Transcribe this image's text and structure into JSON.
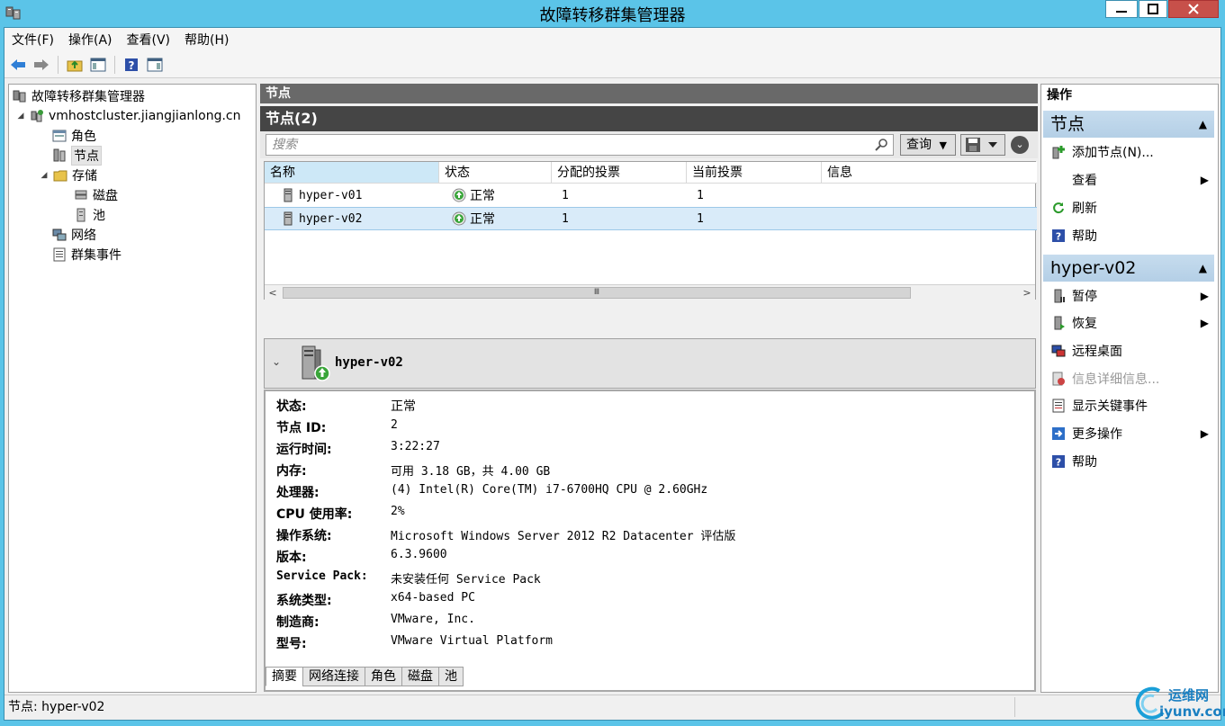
{
  "window": {
    "title": "故障转移群集管理器"
  },
  "menu": [
    "文件(F)",
    "操作(A)",
    "查看(V)",
    "帮助(H)"
  ],
  "tree": {
    "root": "故障转移群集管理器",
    "cluster": "vmhostcluster.jiangjianlong.cn",
    "roles": "角色",
    "nodes": "节点",
    "storage": "存储",
    "disks": "磁盘",
    "pools": "池",
    "network": "网络",
    "events": "群集事件"
  },
  "center": {
    "header": "节点",
    "subheader": "节点(2)",
    "search_placeholder": "搜索",
    "query_label": "查询",
    "columns": [
      "名称",
      "状态",
      "分配的投票",
      "当前投票",
      "信息"
    ],
    "rows": [
      {
        "name": "hyper-v01",
        "status": "正常",
        "assigned": "1",
        "current": "1",
        "info": ""
      },
      {
        "name": "hyper-v02",
        "status": "正常",
        "assigned": "1",
        "current": "1",
        "info": ""
      }
    ],
    "scroll_thumb": "Ⅲ"
  },
  "detail": {
    "name": "hyper-v02",
    "props": [
      {
        "k": "状态:",
        "v": "正常"
      },
      {
        "k": "节点 ID:",
        "v": "2"
      },
      {
        "k": "运行时间:",
        "v": "3:22:27"
      },
      {
        "k": "内存:",
        "v": "可用 3.18 GB，共 4.00 GB"
      },
      {
        "k": "处理器:",
        "v": "(4) Intel(R) Core(TM) i7-6700HQ CPU @ 2.60GHz"
      },
      {
        "k": "CPU 使用率:",
        "v": "2%"
      },
      {
        "k": "操作系统:",
        "v": "Microsoft Windows Server 2012 R2 Datacenter 评估版"
      },
      {
        "k": "版本:",
        "v": "6.3.9600"
      },
      {
        "k": "Service Pack:",
        "v": "未安装任何 Service Pack"
      },
      {
        "k": "系统类型:",
        "v": "x64-based PC"
      },
      {
        "k": "制造商:",
        "v": "VMware, Inc."
      },
      {
        "k": "型号:",
        "v": "VMware Virtual Platform"
      }
    ],
    "tabs": [
      "摘要",
      "网络连接",
      "角色",
      "磁盘",
      "池"
    ]
  },
  "actions": {
    "header": "操作",
    "section1": "节点",
    "section1_items": [
      "添加节点(N)...",
      "查看",
      "刷新",
      "帮助"
    ],
    "section2": "hyper-v02",
    "section2_items": [
      "暂停",
      "恢复",
      "远程桌面",
      "信息详细信息...",
      "显示关键事件",
      "更多操作",
      "帮助"
    ]
  },
  "status": {
    "text": "节点: hyper-v02"
  },
  "watermark": {
    "line1": "运维网",
    "line2": "iyunv.com"
  },
  "colors": {
    "titlebar": "#5bc4e8",
    "selection": "#d9ebf9",
    "section": "#c6dcee",
    "ok_green": "#3aa53a"
  }
}
